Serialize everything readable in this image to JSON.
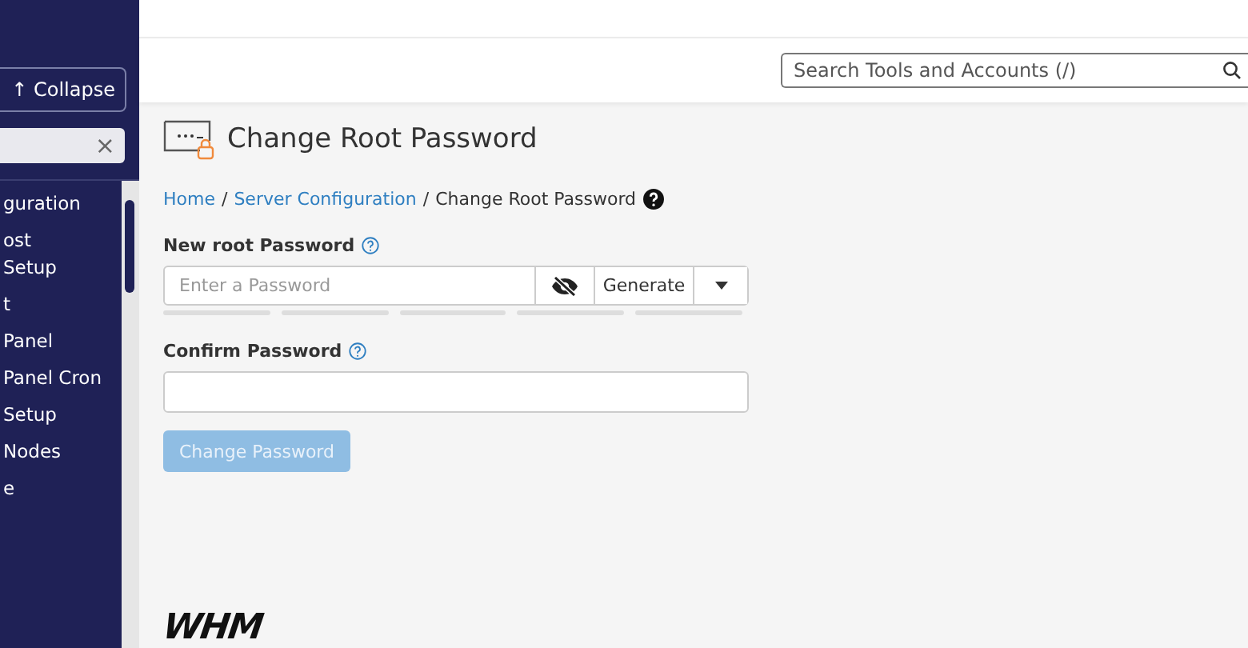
{
  "sidebar": {
    "collapse_button": "↑ Collapse",
    "filter": {
      "clear": "×"
    },
    "items": [
      {
        "lines": [
          "guration"
        ]
      },
      {
        "lines": [
          "ost",
          "Setup"
        ]
      },
      {
        "lines": [
          "t"
        ]
      },
      {
        "lines": [
          "Panel"
        ]
      },
      {
        "lines": [
          "Panel Cron"
        ]
      },
      {
        "lines": [
          "Setup"
        ]
      },
      {
        "lines": [
          "Nodes"
        ]
      },
      {
        "lines": [
          "e"
        ]
      }
    ]
  },
  "search": {
    "placeholder": "Search Tools and Accounts (/)"
  },
  "page": {
    "title": "Change Root Password",
    "breadcrumb": [
      {
        "label": "Home",
        "link": true,
        "separator": "/"
      },
      {
        "label": "Server Configuration",
        "link": true,
        "separator": "/"
      },
      {
        "label": "Change Root Password",
        "link": false
      }
    ],
    "new_password": {
      "label": "New root Password",
      "placeholder": "Enter a Password",
      "generate": "Generate",
      "strength_segments": [
        false,
        false,
        false,
        false,
        false
      ]
    },
    "confirm_password": {
      "label": "Confirm Password"
    },
    "submit": {
      "label": "Change Password",
      "disabled": true
    },
    "logo": "WHM"
  }
}
